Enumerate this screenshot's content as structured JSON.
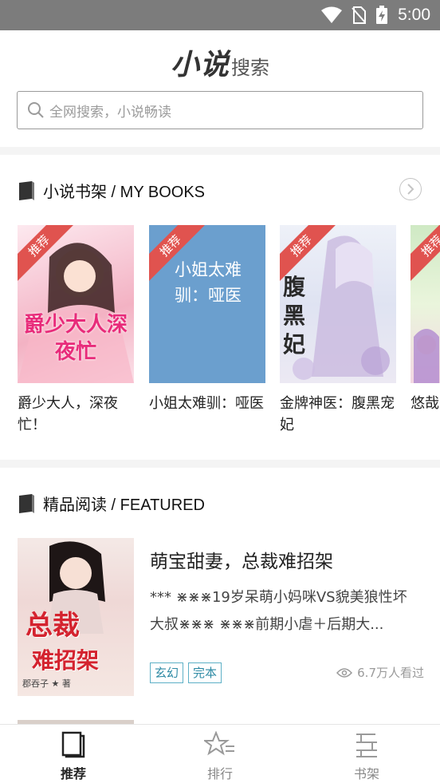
{
  "status_bar": {
    "time": "5:00",
    "icons": [
      "wifi-icon",
      "no-sim-icon",
      "battery-charging-icon"
    ]
  },
  "header": {
    "logo_main": "小说",
    "logo_sub": "搜索",
    "search_placeholder": "全网搜索，小说畅读"
  },
  "bookshelf": {
    "title": "小说书架 /  MY BOOKS",
    "ribbon": "推荐",
    "books": [
      {
        "title": "爵少大人，深夜忙！",
        "cover_text": "爵少大人深夜忙"
      },
      {
        "title": "小姐太难驯：哑医",
        "cover_text": "小姐太难驯：哑医"
      },
      {
        "title": "金牌神医：腹黑宠妃",
        "cover_text": "腹黑妃"
      },
      {
        "title": "悠哉田，",
        "cover_text": ""
      }
    ]
  },
  "featured": {
    "title": "精品阅读 /  FEATURED",
    "items": [
      {
        "title": "萌宝甜妻，总裁难招架",
        "description": "*** ⋇⋇⋇19岁呆萌小妈咪VS貌美狼性坏大叔⋇⋇⋇ ⋇⋇⋇前期小虐＋后期大...",
        "tags": [
          "玄幻",
          "完本"
        ],
        "views": "6.7万人看过",
        "cover_text_top": "总裁",
        "cover_text_bottom": "难招架",
        "cover_author": "郡吞子 ★ 著"
      }
    ]
  },
  "bottom_nav": {
    "items": [
      {
        "label": "推荐",
        "active": true
      },
      {
        "label": "排行",
        "active": false
      },
      {
        "label": "书架",
        "active": false
      }
    ]
  },
  "colors": {
    "accent": "#e0534f",
    "tag": "#5db0c6",
    "status_bar": "#7c7c7c"
  }
}
